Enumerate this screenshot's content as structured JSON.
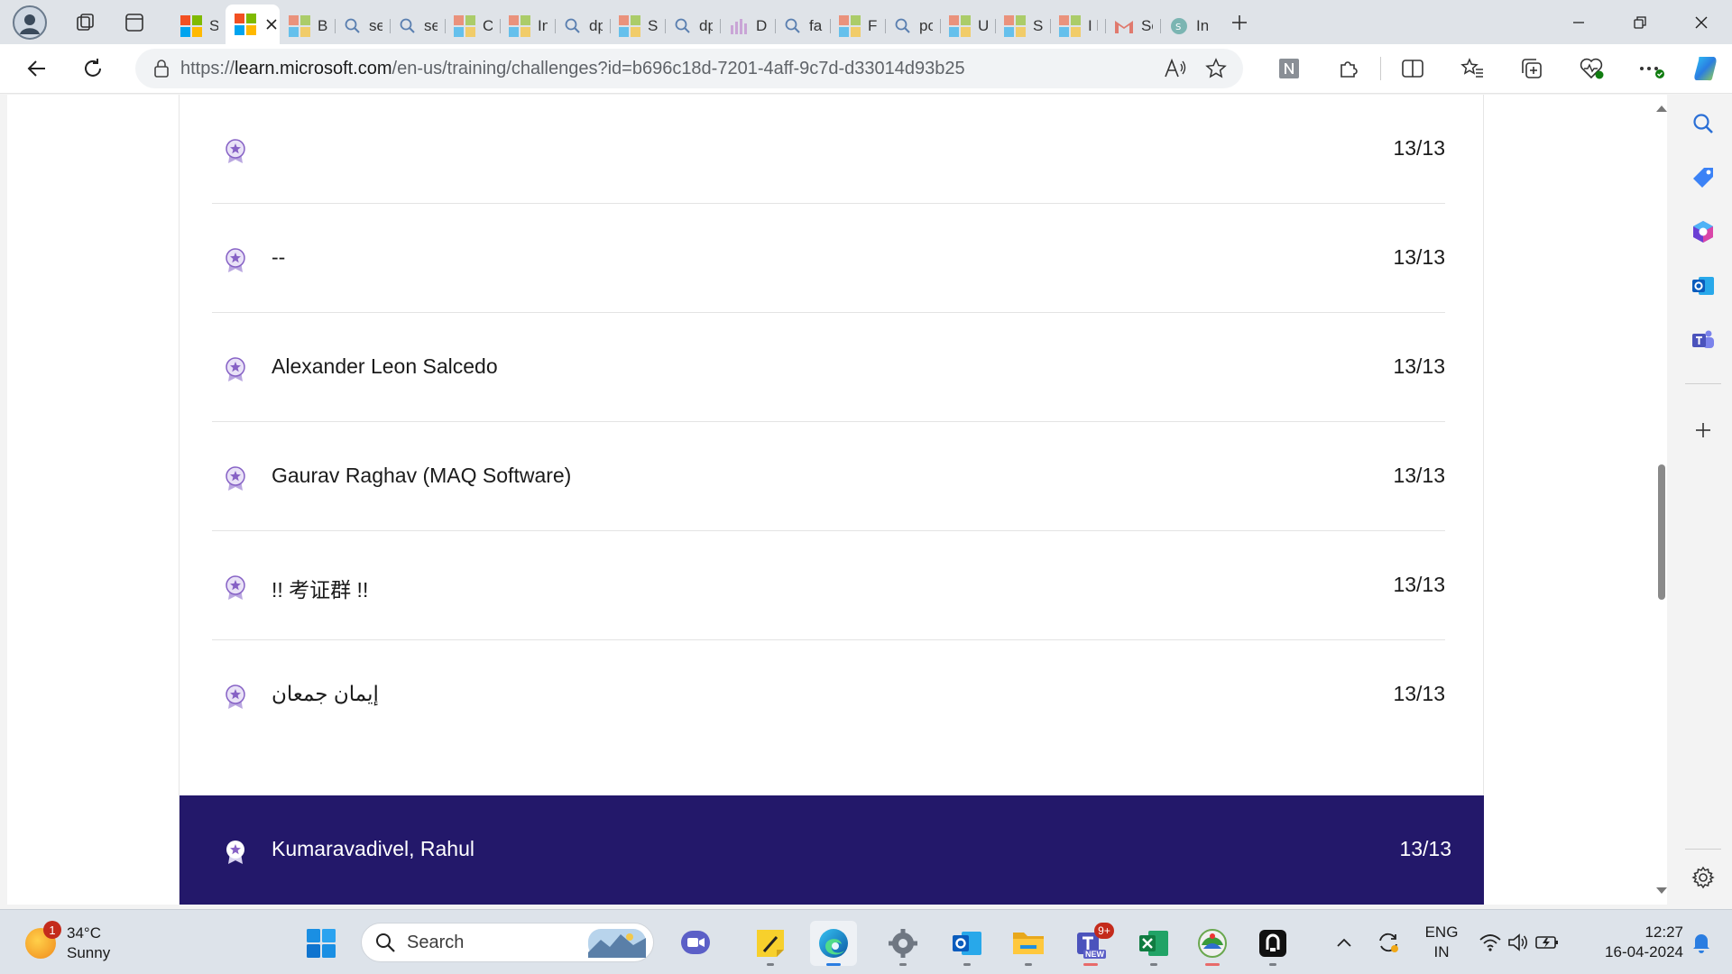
{
  "tabs": [
    {
      "label": "Stu",
      "icon": "microsoft-icon"
    },
    {
      "label": "",
      "icon": "microsoft-icon",
      "active": true
    },
    {
      "label": "Bro",
      "icon": "microsoft-icon"
    },
    {
      "label": "ser",
      "icon": "search-icon"
    },
    {
      "label": "ser",
      "icon": "search-icon"
    },
    {
      "label": "Ch",
      "icon": "microsoft-icon"
    },
    {
      "label": "Int",
      "icon": "microsoft-icon"
    },
    {
      "label": "dp",
      "icon": "search-icon"
    },
    {
      "label": "Stu",
      "icon": "microsoft-icon"
    },
    {
      "label": "dp",
      "icon": "search-icon"
    },
    {
      "label": "DP",
      "icon": "chart-icon"
    },
    {
      "label": "fab",
      "icon": "search-icon"
    },
    {
      "label": "Fab",
      "icon": "microsoft-icon"
    },
    {
      "label": "po",
      "icon": "search-icon"
    },
    {
      "label": "Us",
      "icon": "microsoft-icon"
    },
    {
      "label": "Stu",
      "icon": "microsoft-icon"
    },
    {
      "label": "I ha",
      "icon": "microsoft-icon"
    },
    {
      "label": "Sea",
      "icon": "gmail-icon"
    },
    {
      "label": "Inc",
      "icon": "web-icon"
    }
  ],
  "address": {
    "scheme": "https://",
    "domain": "learn.microsoft.com",
    "path": "/en-us/training/challenges?id=b696c18d-7201-4aff-9c7d-d33014d93b25"
  },
  "leaderboard": {
    "rows": [
      {
        "name": "",
        "score": "13/13"
      },
      {
        "name": "--",
        "score": "13/13"
      },
      {
        "name": "Alexander Leon Salcedo",
        "score": "13/13"
      },
      {
        "name": "Gaurav Raghav (MAQ Software)",
        "score": "13/13"
      },
      {
        "name": "!! 考证群 !!",
        "score": "13/13"
      },
      {
        "name": "إيمان جمعان",
        "score": "13/13"
      }
    ],
    "current_user": {
      "name": "Kumaravadivel, Rahul",
      "score": "13/13"
    }
  },
  "taskbar": {
    "weather": {
      "temp": "34°C",
      "condition": "Sunny",
      "badge": "1"
    },
    "search_placeholder": "Search",
    "teams_badge": "9+",
    "teams_new": "NEW",
    "lang": "ENG",
    "region": "IN",
    "time": "12:27",
    "date": "16-04-2024"
  },
  "colors": {
    "highlight_row": "#23186a",
    "badge_purple": "#8661c5",
    "edge_accent": "#0078d4"
  }
}
